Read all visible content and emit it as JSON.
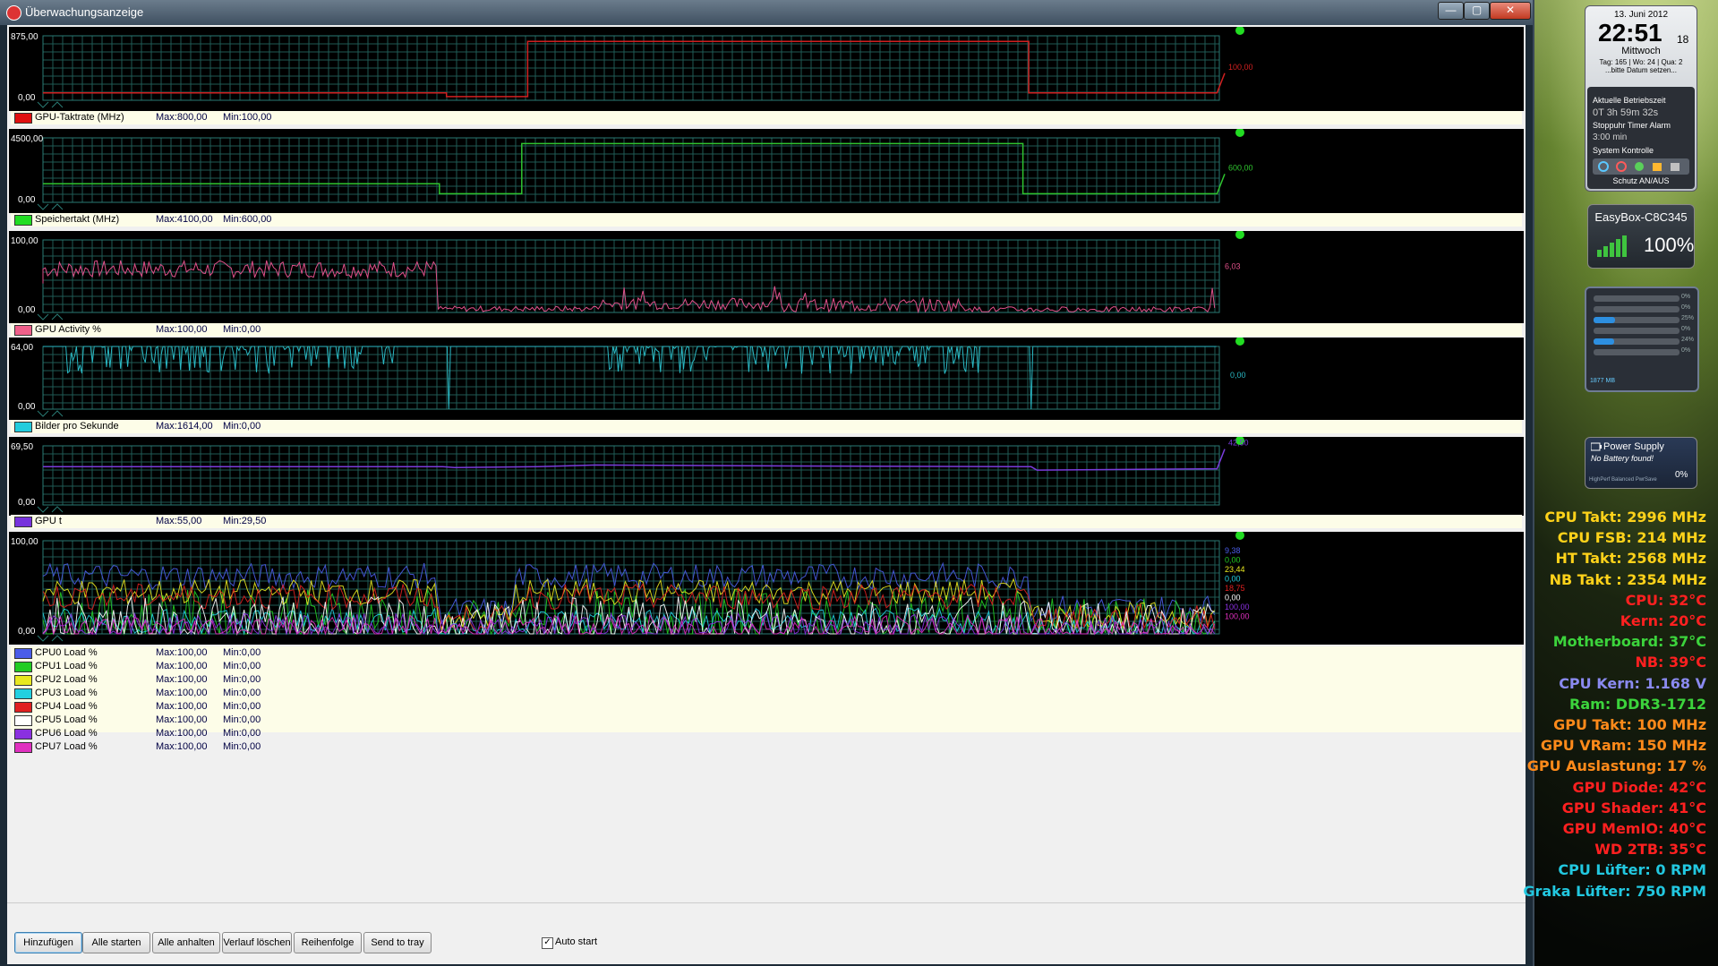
{
  "window": {
    "title": "Überwachungsanzeige",
    "minimize_glyph": "—",
    "maximize_glyph": "▢",
    "close_glyph": "✕"
  },
  "graphs": [
    {
      "id": "gpu-clock",
      "y_max_label": "875,00",
      "y_min_label": "0,00",
      "y_max": 875,
      "current_label": "100,00",
      "color": "#d02020",
      "style": "step",
      "values": [
        [
          0,
          100
        ],
        [
          0.343,
          100
        ],
        [
          0.343,
          50
        ],
        [
          0.412,
          50
        ],
        [
          0.412,
          800
        ],
        [
          0.838,
          800
        ],
        [
          0.838,
          100
        ],
        [
          0.998,
          100
        ]
      ],
      "legend": [
        {
          "name": "GPU-Taktrate (MHz)",
          "max": "Max:800,00",
          "min": "Min:100,00",
          "color": "#e01010"
        }
      ]
    },
    {
      "id": "memory-clock",
      "y_max_label": "4500,00",
      "y_min_label": "0,00",
      "y_max": 4500,
      "current_label": "600,00",
      "color": "#2fc42f",
      "style": "step",
      "values": [
        [
          0,
          1300
        ],
        [
          0.337,
          1300
        ],
        [
          0.337,
          600
        ],
        [
          0.407,
          600
        ],
        [
          0.407,
          4100
        ],
        [
          0.833,
          4100
        ],
        [
          0.833,
          600
        ],
        [
          0.998,
          600
        ]
      ],
      "legend": [
        {
          "name": "Speichertakt (MHz)",
          "max": "Max:4100,00",
          "min": "Min:600,00",
          "color": "#22dd22"
        }
      ]
    },
    {
      "id": "gpu-activity",
      "y_max_label": "100,00",
      "y_min_label": "0,00",
      "y_max": 100,
      "current_label": "6,03",
      "color": "#e0508a",
      "style": "noisy",
      "segments": [
        [
          0,
          0.335,
          60,
          12
        ],
        [
          0.335,
          0.47,
          5,
          4
        ],
        [
          0.47,
          0.63,
          12,
          8
        ],
        [
          0.63,
          0.79,
          10,
          10
        ],
        [
          0.79,
          0.998,
          4,
          4
        ]
      ],
      "legend": [
        {
          "name": "GPU Activity %",
          "max": "Max:100,00",
          "min": "Min:0,00",
          "color": "#f0608a"
        }
      ]
    },
    {
      "id": "fps",
      "y_max_label": "64,00",
      "y_min_label": "0,00",
      "y_max": 64,
      "current_label": "0,00",
      "color": "#2ab8c4",
      "style": "fps",
      "legend": [
        {
          "name": "Bilder pro Sekunde",
          "max": "Max:1614,00",
          "min": "Min:0,00",
          "color": "#22ccdd"
        }
      ]
    },
    {
      "id": "gpu-temp",
      "y_max_label": "69,50",
      "y_min_label": "0,00",
      "y_max": 69.5,
      "current_label": "42,50",
      "color": "#7a3cdc",
      "style": "temp",
      "values": [
        [
          0,
          45
        ],
        [
          0.34,
          45
        ],
        [
          0.35,
          44
        ],
        [
          0.42,
          45
        ],
        [
          0.47,
          47
        ],
        [
          0.6,
          46
        ],
        [
          0.84,
          45
        ],
        [
          0.845,
          41
        ],
        [
          0.998,
          42.5
        ]
      ],
      "legend": [
        {
          "name": "GPU t",
          "max": "Max:55,00",
          "min": "Min:29,50",
          "color": "#7733dd"
        }
      ]
    },
    {
      "id": "cpu-load",
      "y_max_label": "100,00",
      "y_min_label": "0,00",
      "y_max": 100,
      "current_labels": [
        "9,38",
        "0,00",
        "23,44",
        "0,00",
        "18,75",
        "0,00",
        "100,00",
        "100,00"
      ],
      "style": "multi",
      "legend": [
        {
          "name": "CPU0 Load %",
          "max": "Max:100,00",
          "min": "Min:0,00",
          "color": "#4a5de8"
        },
        {
          "name": "CPU1 Load %",
          "max": "Max:100,00",
          "min": "Min:0,00",
          "color": "#22cc22"
        },
        {
          "name": "CPU2 Load %",
          "max": "Max:100,00",
          "min": "Min:0,00",
          "color": "#e8e820"
        },
        {
          "name": "CPU3 Load %",
          "max": "Max:100,00",
          "min": "Min:0,00",
          "color": "#22d0e0"
        },
        {
          "name": "CPU4 Load %",
          "max": "Max:100,00",
          "min": "Min:0,00",
          "color": "#e02020"
        },
        {
          "name": "CPU5 Load %",
          "max": "Max:100,00",
          "min": "Min:0,00",
          "color": "#ffffff"
        },
        {
          "name": "CPU6 Load %",
          "max": "Max:100,00",
          "min": "Min:0,00",
          "color": "#8a30e0"
        },
        {
          "name": "CPU7 Load %",
          "max": "Max:100,00",
          "min": "Min:0,00",
          "color": "#e030c0"
        }
      ]
    }
  ],
  "buttons": [
    {
      "label": "Hinzufügen"
    },
    {
      "label": "Alle starten"
    },
    {
      "label": "Alle anhalten"
    },
    {
      "label": "Verlauf löschen"
    },
    {
      "label": "Reihenfolge"
    },
    {
      "label": "Send to tray"
    }
  ],
  "autostart": {
    "label": "Auto start",
    "checked": true,
    "mark": "✓"
  },
  "clock_gadget": {
    "date": "13. Juni 2012",
    "time": "22:51",
    "seconds": "18",
    "weekday": "Mittwoch",
    "week_info": "Tag: 165 | Wo: 24 | Qua: 2",
    "hint": "...bitte Datum setzen...",
    "uptime_label": "Aktuelle Betriebszeit",
    "uptime": "0T 3h 59m 32s",
    "timer_label": "Stoppuhr Timer Alarm",
    "timer_value": "3:00 min",
    "system_label": "System Kontrolle",
    "protect_label": "Schutz AN/AUS"
  },
  "wifi_gadget": {
    "name": "EasyBox-C8C345",
    "signal": "100%"
  },
  "meters_gadget": {
    "levels": [
      0,
      0,
      0.25,
      0,
      0.24,
      0
    ],
    "labels": [
      "0%",
      "0%",
      "25%",
      "0%",
      "24%",
      "0%"
    ],
    "memory": "1877 MB"
  },
  "power_gadget": {
    "title": "Power Supply",
    "subtitle": "No Battery found!",
    "percent": "0%",
    "modes": "HighPerf  Balanced  PwrSave"
  },
  "sensors": [
    {
      "text": "CPU Takt: 2996 MHz",
      "color": "#ffd21a"
    },
    {
      "text": "CPU FSB: 214 MHz",
      "color": "#ffd21a"
    },
    {
      "text": "HT Takt: 2568 MHz",
      "color": "#ffd21a"
    },
    {
      "text": "NB Takt : 2354 MHz",
      "color": "#ffd21a"
    },
    {
      "text": "CPU: 32°C",
      "color": "#ff2020"
    },
    {
      "text": "Kern: 20°C",
      "color": "#ff2020"
    },
    {
      "text": "Motherboard: 37°C",
      "color": "#3cd43c"
    },
    {
      "text": "NB: 39°C",
      "color": "#ff2020"
    },
    {
      "text": "CPU Kern: 1.168 V",
      "color": "#8a8af0"
    },
    {
      "text": "Ram: DDR3-1712",
      "color": "#3cd43c"
    },
    {
      "text": "GPU Takt: 100 MHz",
      "color": "#ff8a1a"
    },
    {
      "text": "GPU VRam: 150 MHz",
      "color": "#ff8a1a"
    },
    {
      "text": "GPU Auslastung: 17 %",
      "color": "#ff8a1a"
    },
    {
      "text": "GPU Diode: 42°C",
      "color": "#ff2020"
    },
    {
      "text": "GPU Shader: 41°C",
      "color": "#ff2020"
    },
    {
      "text": "GPU MemIO: 40°C",
      "color": "#ff2020"
    },
    {
      "text": "WD 2TB: 35°C",
      "color": "#ff2020"
    },
    {
      "text": "CPU Lüfter: 0 RPM",
      "color": "#22c8e0"
    },
    {
      "text": "Graka Lüfter: 750 RPM",
      "color": "#22c8e0"
    }
  ]
}
